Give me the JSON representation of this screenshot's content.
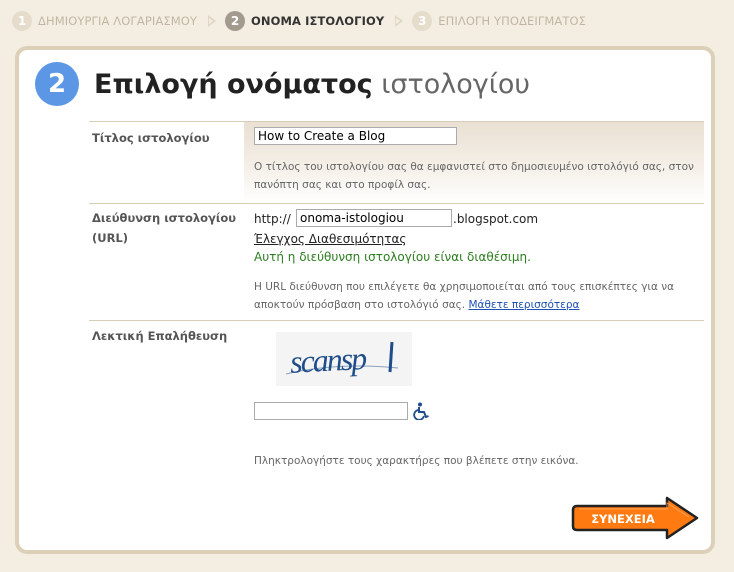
{
  "steps": [
    {
      "num": "1",
      "label": "ΔΗΜΙΟΥΡΓΙΑ ΛΟΓΑΡΙΑΣΜΟΥ"
    },
    {
      "num": "2",
      "label": "ΟΝΟΜΑ ΙΣΤΟΛΟΓΙΟΥ"
    },
    {
      "num": "3",
      "label": "ΕΠΙΛΟΓΗ ΥΠΟΔΕΙΓΜΑΤΟΣ"
    }
  ],
  "heading": {
    "num": "2",
    "title_bold": "Επιλογή ονόματος",
    "title_light": "ιστολογίου"
  },
  "blog_title": {
    "label": "Τίτλος ιστολογίου",
    "value": "How to Create a Blog",
    "help_line1": "Ο τίτλος του ιστολογίου σας θα εμφανιστεί στο δημοσιευμένο ιστολόγιό σας, στον",
    "help_line2": "πανόπτη σας και στο προφίλ σας."
  },
  "blog_url": {
    "label_line1": "Διεύθυνση ιστολογίου",
    "label_line2": "(URL)",
    "prefix": "http://",
    "value": "onoma-istologiou",
    "suffix": ".blogspot.com",
    "check_link": "Έλεγχος Διαθεσιμότητας",
    "available_msg": "Αυτή η διεύθυνση ιστολογίου είναι διαθέσιμη.",
    "help_line1": "Η URL διεύθυνση που επιλέγετε θα χρησιμοποιείται από τους επισκέπτες για να",
    "help_line2": "αποκτούν πρόσβαση στο ιστολόγιό σας.",
    "learn_more": "Μάθετε περισσότερα"
  },
  "verification": {
    "label": "Λεκτική Επαλήθευση",
    "captcha_text": "scansp",
    "input_value": "",
    "help": "Πληκτρολογήστε τους χαρακτήρες που βλέπετε στην εικόνα."
  },
  "continue_button": {
    "label": "ΣΥΝΕΧΕΙΑ"
  },
  "colors": {
    "accent_blue": "#5c97e6",
    "button_orange": "#ff7a10",
    "available_green": "#2e7d22",
    "link_blue": "#1e50b4"
  },
  "icons": [
    "wheelchair-accessibility-icon",
    "arrow-right-icon"
  ]
}
